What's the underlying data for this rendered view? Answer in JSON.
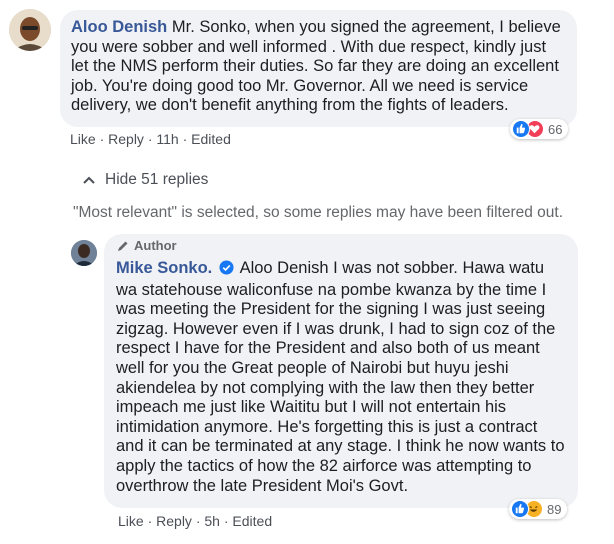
{
  "comment": {
    "author": "Aloo Denish",
    "text": "Mr. Sonko, when you signed the agreement, I believe you were sobber and well informed . With due respect, kindly just let the NMS perform their duties. So far they are doing an excellent job. You're doing good too Mr. Governor. All we need is service delivery, we don't benefit anything from the fights of leaders.",
    "reaction_count": "66",
    "reaction_icons": [
      "like-icon",
      "love-icon"
    ],
    "actions": {
      "like": "Like",
      "reply": "Reply",
      "time": "11h",
      "edited": "Edited",
      "sep": "·"
    }
  },
  "thread": {
    "hide_label": "Hide 51 replies",
    "relevance_note": "\"Most relevant\" is selected, so some replies may have been filtered out."
  },
  "reply": {
    "badge": "Author",
    "author": "Mike Sonko.",
    "text": "Aloo Denish I was not sobber. Hawa watu wa statehouse waliconfuse na pombe kwanza by the time I was meeting the President for the signing I was just seeing zigzag. However even if I was drunk, I had to sign coz of the respect I have for the President and also both of us meant well for you the Great people of Nairobi but huyu jeshi akiendelea by not complying with the law then they better impeach me just like Waititu but I will not entertain his intimidation anymore. He's forgetting this is just a contract and it can be terminated at any stage. I think he now wants to apply the tactics of how the 82 airforce was attempting to overthrow the late President Moi's Govt.",
    "reaction_count": "89",
    "reaction_icons": [
      "like-icon",
      "haha-icon"
    ],
    "actions": {
      "like": "Like",
      "reply": "Reply",
      "time": "5h",
      "edited": "Edited",
      "sep": "·"
    }
  },
  "colors": {
    "link": "#385898",
    "bubble": "#f0f2f5",
    "like": "#1877f2",
    "love": "#f33e58",
    "verified": "#1877f2"
  }
}
